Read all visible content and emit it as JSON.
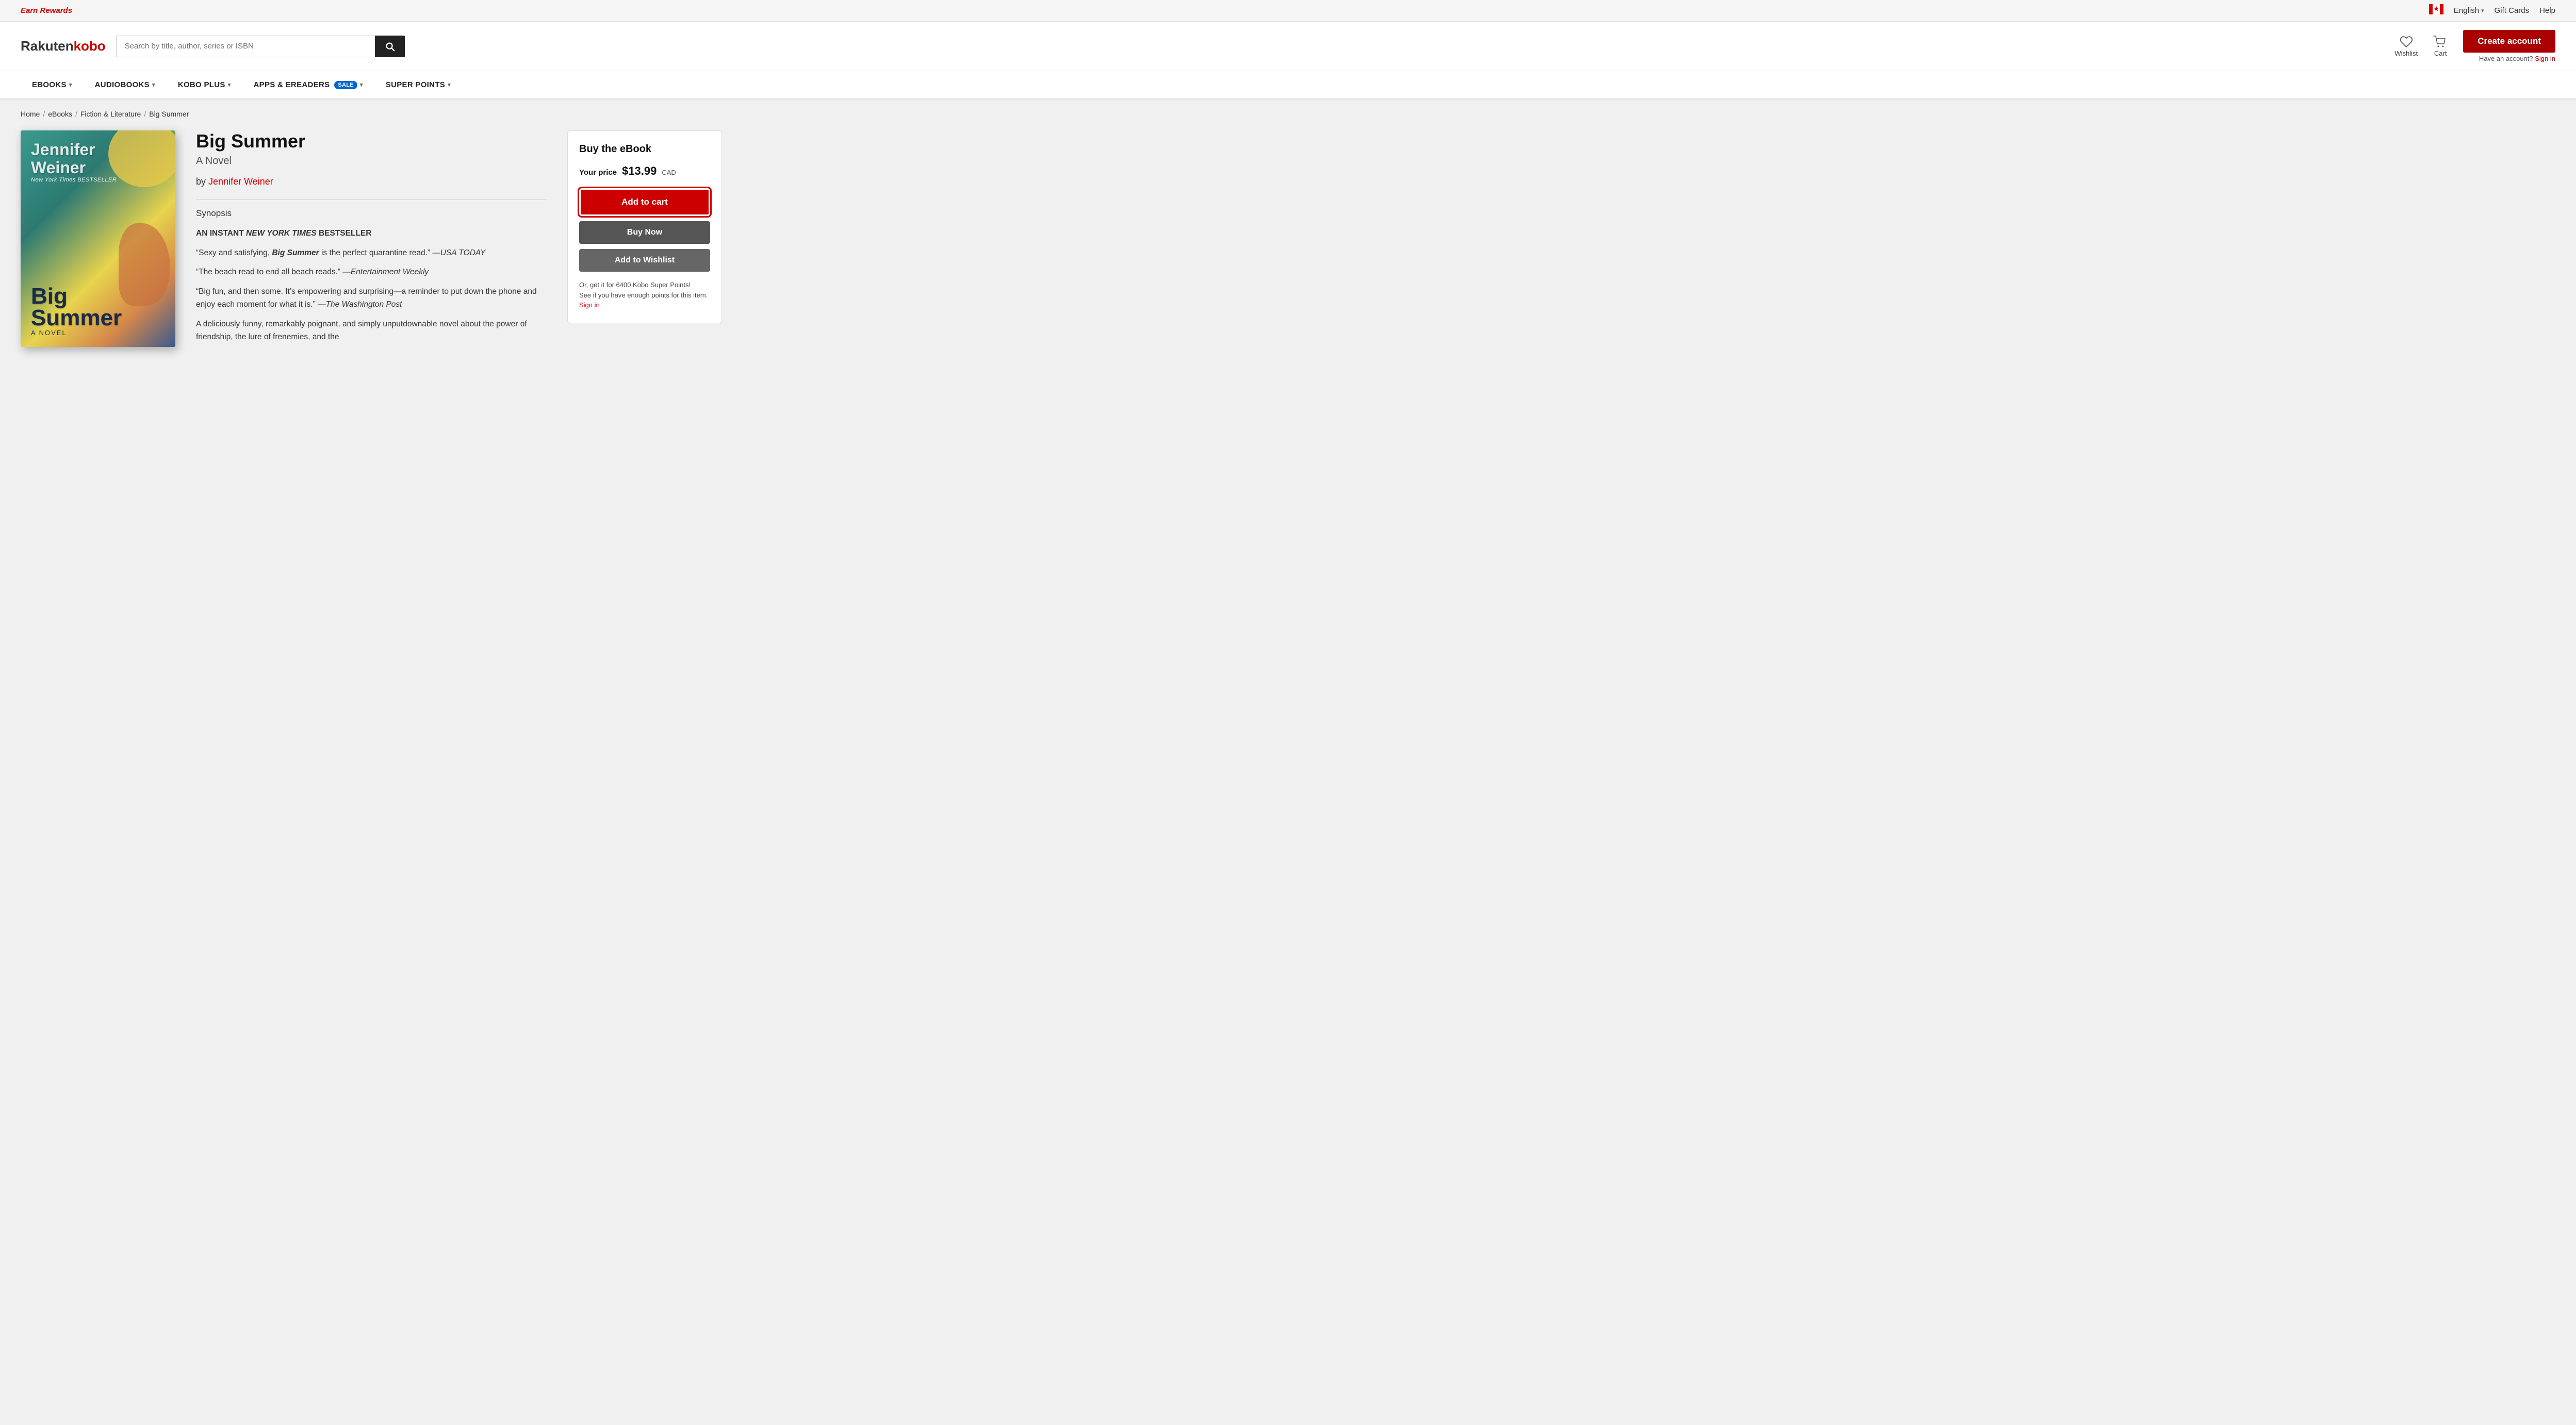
{
  "topbar": {
    "earn_rewards": "Earn Rewards",
    "language": "English",
    "gift_cards": "Gift Cards",
    "help": "Help"
  },
  "header": {
    "logo_rakuten": "Rakuten",
    "logo_kobo": "kobo",
    "search_placeholder": "Search by title, author, series or ISBN",
    "wishlist_label": "Wishlist",
    "cart_label": "Cart",
    "create_account": "Create account",
    "have_account": "Have an account?",
    "sign_in": "Sign in"
  },
  "nav": {
    "items": [
      {
        "label": "eBOOKS",
        "has_dropdown": true
      },
      {
        "label": "AUDIOBOOKS",
        "has_dropdown": true
      },
      {
        "label": "KOBO PLUS",
        "has_dropdown": true
      },
      {
        "label": "APPS & eREADERS",
        "has_dropdown": true,
        "badge": "SALE"
      },
      {
        "label": "SUPER POINTS",
        "has_dropdown": true
      }
    ]
  },
  "breadcrumb": {
    "home": "Home",
    "ebooks": "eBooks",
    "fiction": "Fiction & Literature",
    "current": "Big Summer"
  },
  "book": {
    "title": "Big Summer",
    "subtitle": "A Novel",
    "author_prefix": "by",
    "author_name": "Jennifer Weiner",
    "synopsis_label": "Synopsis",
    "synopsis_lines": [
      "AN INSTANT NEW YORK TIMES BESTSELLER",
      "“Sexy and satisfying, Big Summer is the perfect quarantine read.” —USA TODAY",
      "“The beach read to end all beach reads.” —Entertainment Weekly",
      "“Big fun, and then some. It’s empowering and surprising—a reminder to put down the phone and enjoy each moment for what it is.” —The Washington Post",
      "A deliciously funny, remarkably poignant, and simply unputdownable novel about the power of friendship, the lure of frenemies, and the"
    ]
  },
  "buy_panel": {
    "title": "Buy the eBook",
    "price_label": "Your price",
    "price": "$13.99",
    "currency": "CAD",
    "add_to_cart": "Add to cart",
    "buy_now": "Buy Now",
    "add_to_wishlist": "Add to Wishlist",
    "super_points_line1": "Or, get it for 6400 Kobo Super Points!",
    "super_points_line2": "See if you have enough points for this item.",
    "sign_in": "Sign in"
  }
}
